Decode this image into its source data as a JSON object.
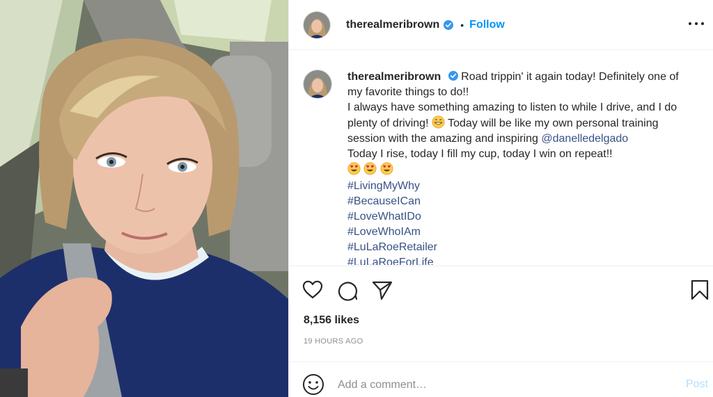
{
  "photo": {
    "alt_icon": "selfie-photo"
  },
  "header": {
    "username": "therealmeribrown",
    "separator": "•",
    "follow_label": "Follow",
    "verified_icon": "verified-badge-icon",
    "more_icon": "more-options-icon"
  },
  "caption": {
    "username": "therealmeribrown",
    "line1": "Road trippin' it again today! Definitely one of my favorite things to do!!",
    "line2a": "I always have something amazing to listen to while I drive, and I do plenty of driving!",
    "line2b": "Today will be like my own personal training session with the amazing and inspiring",
    "mention": "@danelledelgado",
    "line3": "Today I rise, today I fill my cup, today I win on repeat!!",
    "emoji_grin": "grinning-face-emoji",
    "emoji_hearts": "heart-eyes-emoji",
    "hashtags": [
      "#LivingMyWhy",
      "#BecauseICan",
      "#LoveWhatIDo",
      "#LoveWhoIAm",
      "#LuLaRoeRetailer",
      "#LuLaRoeForLife"
    ]
  },
  "actions": {
    "like_icon": "heart-icon",
    "comment_icon": "comment-icon",
    "share_icon": "share-icon",
    "save_icon": "bookmark-icon"
  },
  "likes": "8,156 likes",
  "time_ago": "19 HOURS AGO",
  "add_comment": {
    "placeholder": "Add a comment…",
    "post_label": "Post",
    "emoji_icon": "smiley-icon"
  },
  "colors": {
    "link": "#385185",
    "follow": "#0095f6",
    "post_disabled": "#b2dffc",
    "muted": "#8e8e8e",
    "border": "#efefef"
  }
}
